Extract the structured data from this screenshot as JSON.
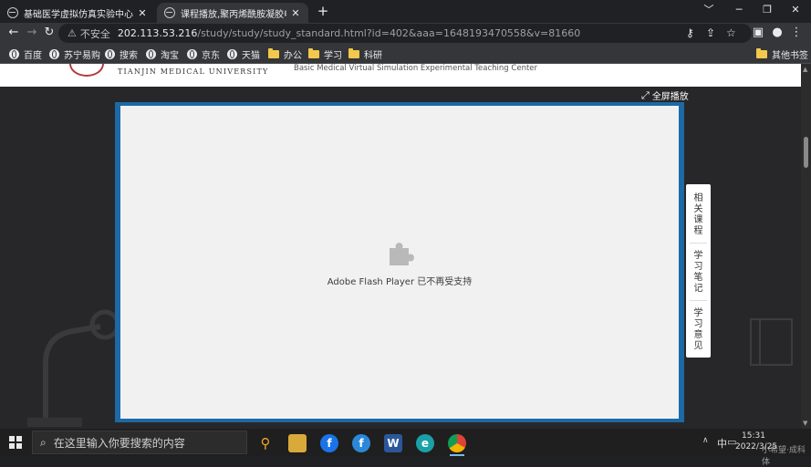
{
  "browser": {
    "tabs": [
      {
        "title": "基础医学虚拟仿真实验中心-首页",
        "active": false
      },
      {
        "title": "课程播放,聚丙烯酰胺凝胶电泳",
        "active": true
      }
    ],
    "new_tab_symbol": "+",
    "window_controls": [
      "﹀",
      "─",
      "❐",
      "✕"
    ],
    "address": {
      "security_label": "不安全",
      "host": "202.113.53.216",
      "path": "/study/study/study_standard.html?id=402&aaa=1648193470558&v=81660"
    },
    "bookmarks": [
      {
        "label": "百度",
        "icon": "globe-icon"
      },
      {
        "label": "苏宁易购",
        "icon": "globe-icon"
      },
      {
        "label": "搜索",
        "icon": "globe-icon"
      },
      {
        "label": "淘宝",
        "icon": "globe-icon"
      },
      {
        "label": "京东",
        "icon": "globe-icon"
      },
      {
        "label": "天猫",
        "icon": "globe-icon"
      },
      {
        "label": "办公",
        "icon": "folder-icon"
      },
      {
        "label": "学习",
        "icon": "folder-icon"
      },
      {
        "label": "科研",
        "icon": "folder-icon"
      }
    ],
    "other_bookmarks": "其他书签"
  },
  "page": {
    "university_name": "TIANJIN MEDICAL UNIVERSITY",
    "center_name": "Basic Medical Virtual Simulation Experimental Teaching Center",
    "fullscreen_label": "全屏播放",
    "player_message": "Adobe Flash Player 已不再受支持",
    "side_panel": [
      "相关课程",
      "学习笔记",
      "学习意见"
    ]
  },
  "taskbar": {
    "search_placeholder": "在这里输入你要搜索的内容",
    "ime": "中",
    "time": "15:31",
    "date": "2022/3/25",
    "watermark": "小希望·成科体"
  },
  "colors": {
    "player_frame": "#1b6aa5",
    "player_bg": "#f1f1f1",
    "browser_chrome": "#35363a"
  }
}
